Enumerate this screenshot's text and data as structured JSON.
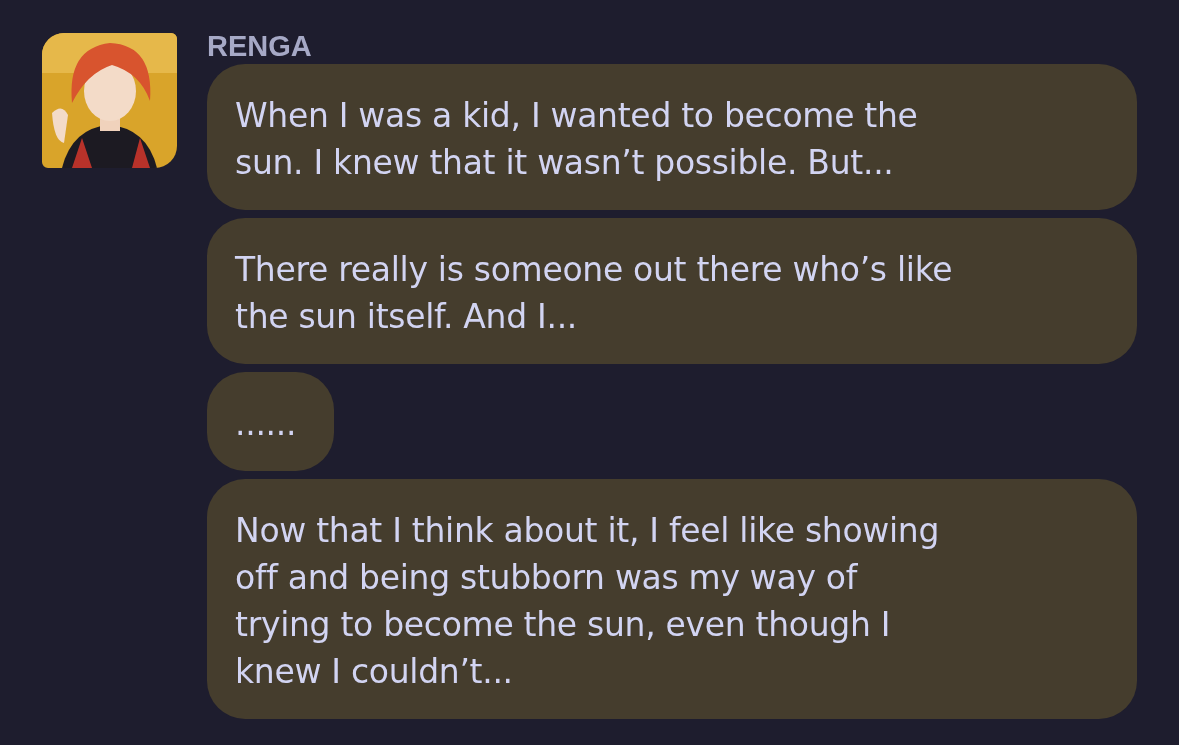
{
  "sender": {
    "name": "RENGA"
  },
  "messages": [
    {
      "lines": [
        "When I was a kid, I wanted to become the",
        "sun. I knew that it wasn’t possible. But..."
      ]
    },
    {
      "lines": [
        "There really is someone out there who’s like",
        "the sun itself. And I..."
      ]
    },
    {
      "lines": [
        "......"
      ]
    },
    {
      "lines": [
        "Now that I think about it, I feel like showing",
        "off and being stubborn was my way of",
        "trying to become the sun, even though I",
        "knew I couldn’t..."
      ]
    }
  ]
}
